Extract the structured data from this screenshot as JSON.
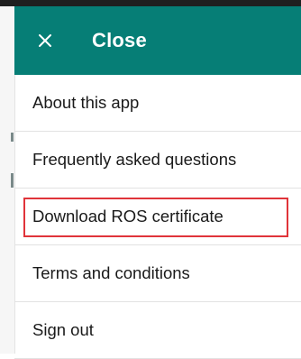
{
  "header": {
    "title": "Close",
    "close_icon": "close-icon",
    "background_color": "#067e76"
  },
  "menu": {
    "items": [
      {
        "label": "About this app"
      },
      {
        "label": "Frequently asked questions"
      },
      {
        "label": "Download ROS certificate",
        "highlighted": true
      },
      {
        "label": "Terms and conditions"
      },
      {
        "label": "Sign out"
      }
    ],
    "highlight_color": "#e0343a"
  }
}
